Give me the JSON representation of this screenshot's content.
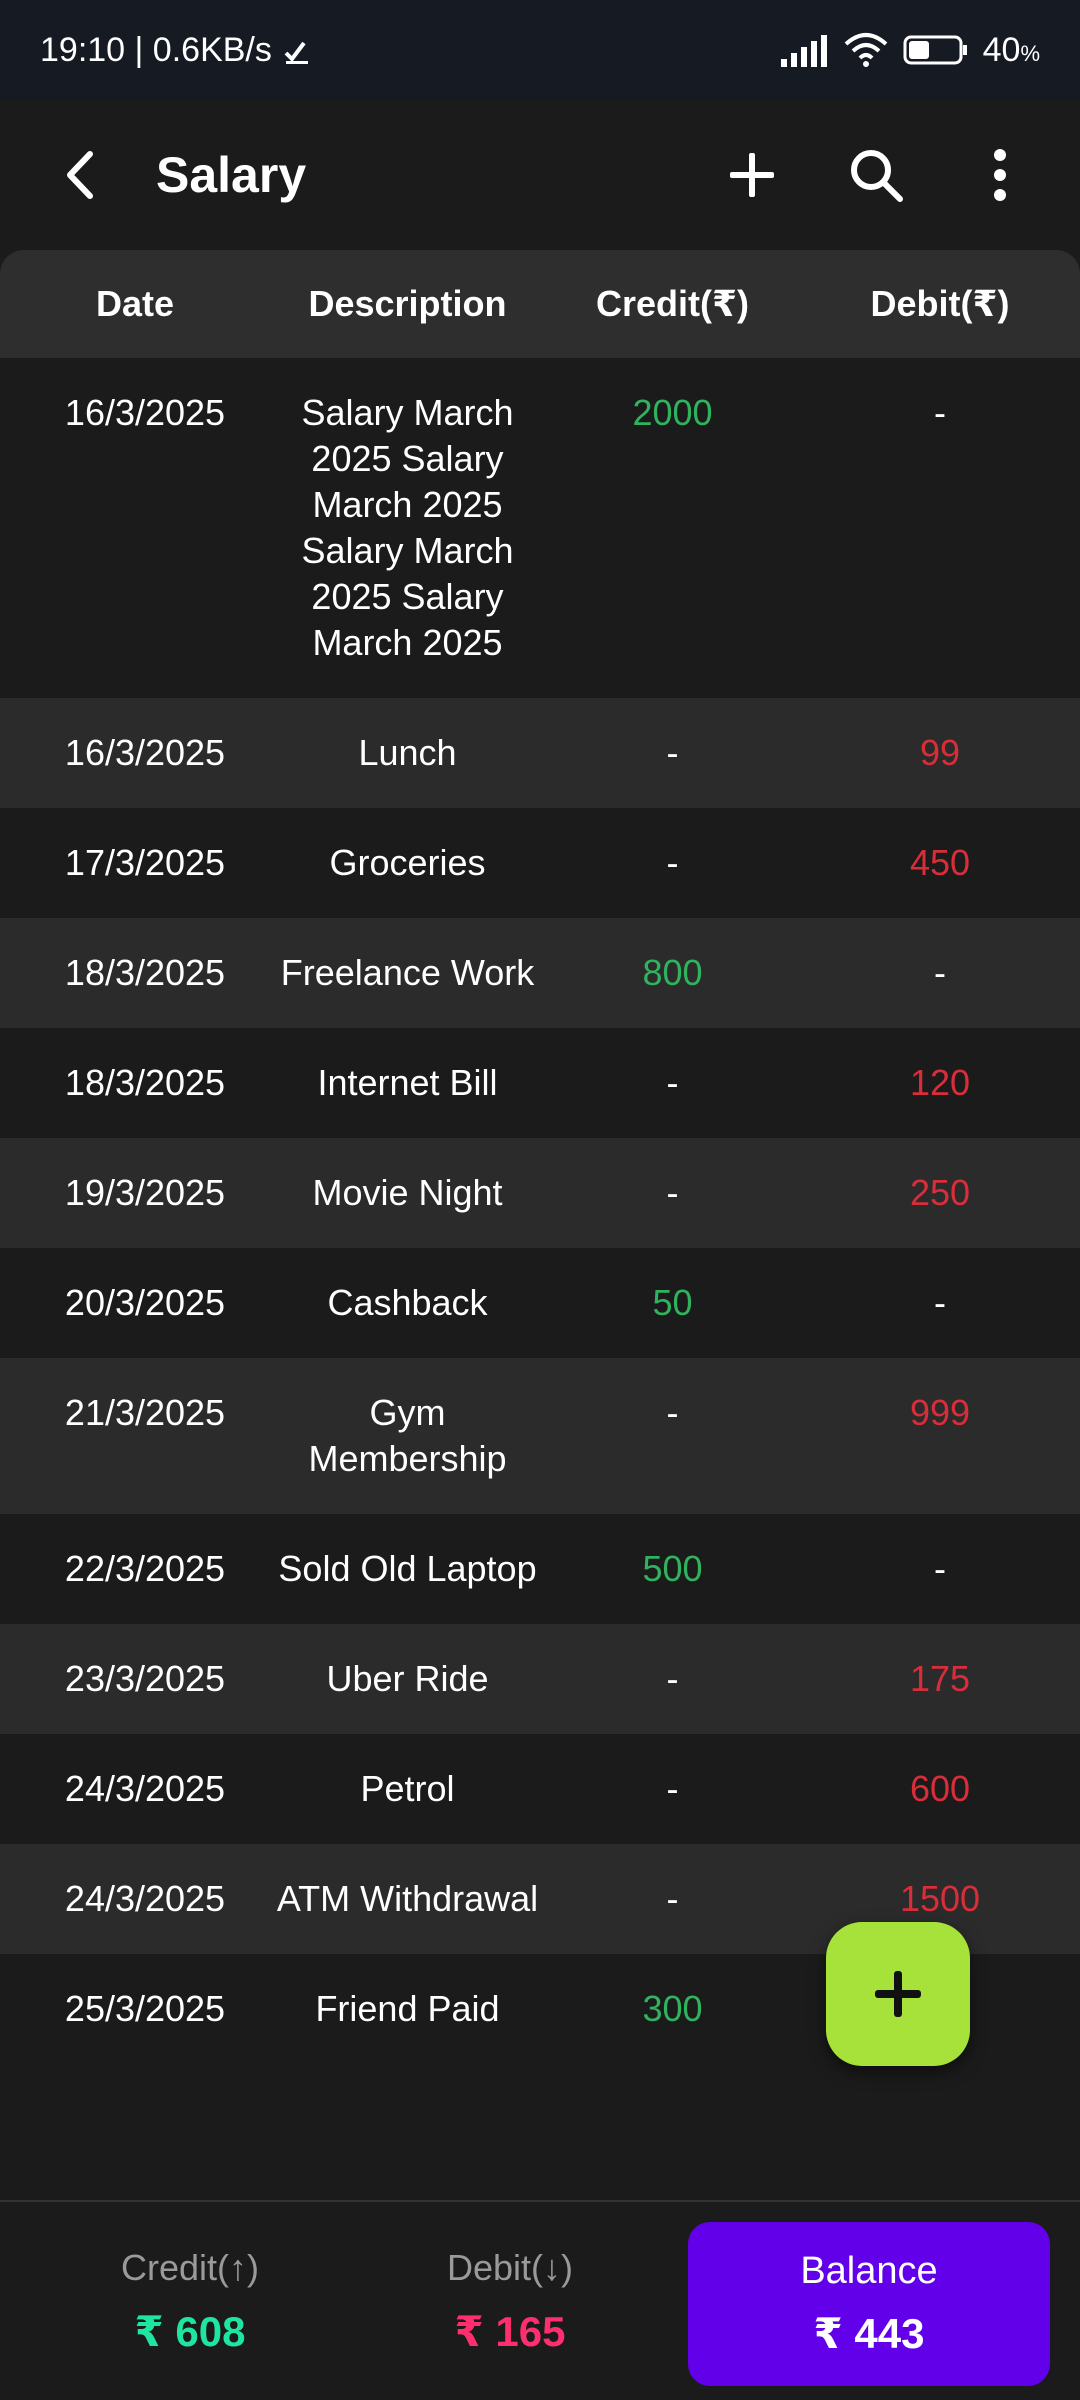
{
  "status_bar": {
    "time_speed": "19:10 | 0.6KB/s",
    "battery": "40",
    "battery_unit": "%"
  },
  "app_bar": {
    "title": "Salary",
    "icons": {
      "back": "chevron-left-icon",
      "add": "plus-icon",
      "search": "search-icon",
      "more": "more-vert-icon"
    }
  },
  "table": {
    "headers": {
      "date": "Date",
      "description": "Description",
      "credit": "Credit(₹)",
      "debit": "Debit(₹)"
    },
    "rows": [
      {
        "date": "16/3/2025",
        "description": "Salary March 2025 Salary March 2025 Salary March 2025 Salary March 2025",
        "credit": "2000",
        "debit": "-"
      },
      {
        "date": "16/3/2025",
        "description": "Lunch",
        "credit": "-",
        "debit": "99"
      },
      {
        "date": "17/3/2025",
        "description": "Groceries",
        "credit": "-",
        "debit": "450"
      },
      {
        "date": "18/3/2025",
        "description": "Freelance Work",
        "credit": "800",
        "debit": "-"
      },
      {
        "date": "18/3/2025",
        "description": "Internet Bill",
        "credit": "-",
        "debit": "120"
      },
      {
        "date": "19/3/2025",
        "description": "Movie Night",
        "credit": "-",
        "debit": "250"
      },
      {
        "date": "20/3/2025",
        "description": "Cashback",
        "credit": "50",
        "debit": "-"
      },
      {
        "date": "21/3/2025",
        "description": "Gym Membership",
        "credit": "-",
        "debit": "999"
      },
      {
        "date": "22/3/2025",
        "description": "Sold Old Laptop",
        "credit": "500",
        "debit": "-"
      },
      {
        "date": "23/3/2025",
        "description": "Uber Ride",
        "credit": "-",
        "debit": "175"
      },
      {
        "date": "24/3/2025",
        "description": "Petrol",
        "credit": "-",
        "debit": "600"
      },
      {
        "date": "24/3/2025",
        "description": "ATM Withdrawal",
        "credit": "-",
        "debit": "1500"
      },
      {
        "date": "25/3/2025",
        "description": "Friend Paid",
        "credit": "300",
        "debit": "-"
      }
    ]
  },
  "summary": {
    "credit_label": "Credit(↑)",
    "credit_value": "₹ 608",
    "debit_label": "Debit(↓)",
    "debit_value": "₹ 165",
    "balance_label": "Balance",
    "balance_value": "₹ 443"
  },
  "fab": {
    "icon": "plus-icon"
  },
  "colors": {
    "credit": "#2fb35e",
    "debit": "#d92d3a",
    "balance_bg": "#6200ea",
    "fab_bg": "#a6e23a",
    "summary_credit": "#1ee6a0",
    "summary_debit": "#ff2e6e"
  }
}
